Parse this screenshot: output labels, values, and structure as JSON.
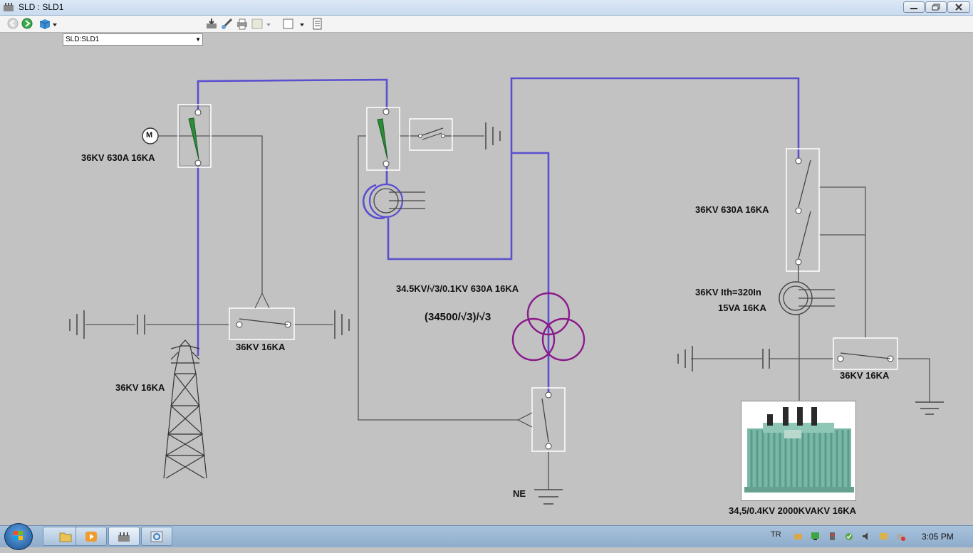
{
  "window": {
    "title": "SLD : SLD1"
  },
  "toolbar": {
    "sld_select_value": "SLD:SLD1"
  },
  "diagram": {
    "labels": {
      "ds1": "36KV 630A 16KA",
      "motor": "M",
      "es1": "36KV 16KA",
      "tower": "36KV 16KA",
      "ct": "34.5KV/√3/0.1KV 630A 16KA",
      "vt_ratio": "(34500/√3)/√3",
      "ne": "NE",
      "ds3": "36KV 630A 16KA",
      "ct2_a": "36KV Ith=320In",
      "ct2_b": "15VA 16KA",
      "es3": "36KV 16KA",
      "transformer": "34,5/0.4KV 2000KVAKV 16KA"
    },
    "colors": {
      "busbar": "#5a4fcf",
      "vt": "#8a1a8a",
      "breaker_blade": "#2e8b3a"
    }
  },
  "taskbar": {
    "language": "TR",
    "clock": "3:05 PM"
  }
}
